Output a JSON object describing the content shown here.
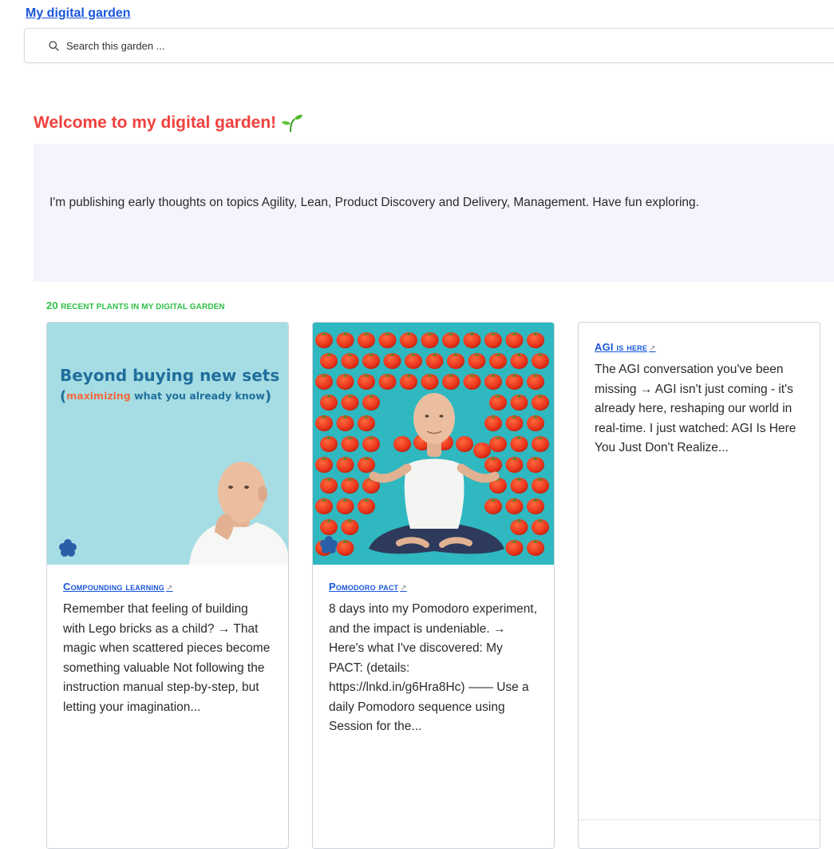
{
  "site": {
    "title": "My digital garden"
  },
  "search": {
    "placeholder": "Search this garden ..."
  },
  "welcome": {
    "heading": "Welcome to my digital garden!"
  },
  "intro": {
    "text": "I'm publishing early thoughts on topics Agility, Lean, Product Discovery and Delivery, Management. Have fun exploring."
  },
  "recent": {
    "count": "20",
    "label": "RECENT PLANTS IN MY DIGITAL GARDEN"
  },
  "cards": [
    {
      "title": "Compounding learning",
      "excerpt": "Remember that feeling of building with Lego bricks as a child? → That magic when scattered pieces become something valuable Not following the instruction manual step-by-step, but letting your imagination...",
      "image_title": "Beyond buying new sets",
      "image_subtitle_a": "(",
      "image_subtitle_highlight": "maximizing",
      "image_subtitle_b": " what you already know",
      "image_subtitle_c": ")"
    },
    {
      "title": "Pomodoro pact",
      "excerpt": "8 days into my Pomodoro experiment, and the impact is undeniable. → Here's what I've discovered: My PACT: (details: https://lnkd.in/g6Hra8Hc) —— Use a daily Pomodoro sequence using Session for the..."
    },
    {
      "title": "AGI is here",
      "excerpt": "The AGI conversation you've been missing → AGI isn't just coming - it's already here, reshaping our world in real-time. I just watched: AGI Is Here You Just Don't Realize..."
    }
  ],
  "colors": {
    "link": "#1a56db",
    "welcome": "#f0413d",
    "section_label": "#2fbf48",
    "intro_bg": "#f4f4fd"
  },
  "icons": {
    "search": "search-icon",
    "sprout": "sprout-icon",
    "external": "external-link-icon"
  }
}
